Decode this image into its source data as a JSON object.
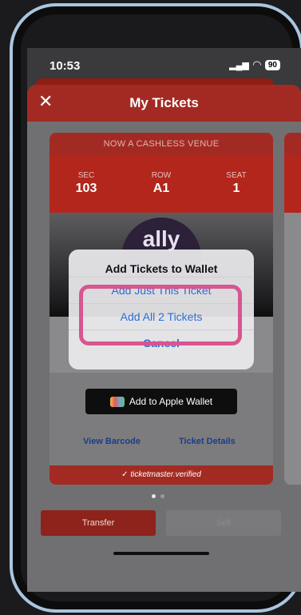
{
  "status_bar": {
    "time": "10:53",
    "battery": "90"
  },
  "header": {
    "title": "My Tickets"
  },
  "ticket": {
    "banner": "NOW A CASHLESS VENUE",
    "sec_label": "SEC",
    "sec_value": "103",
    "row_label": "ROW",
    "row_value": "A1",
    "seat_label": "SEAT",
    "seat_value": "1",
    "logo_text": "ally",
    "wallet_button": "Add to Apple Wallet",
    "view_barcode": "View Barcode",
    "ticket_details": "Ticket Details",
    "verified": "ticketmaster.verified"
  },
  "actions": {
    "transfer": "Transfer",
    "sell": "Sell"
  },
  "dialog": {
    "title": "Add Tickets to Wallet",
    "option1": "Add Just This Ticket",
    "option2": "Add All 2 Tickets",
    "cancel": "Cancel"
  },
  "colors": {
    "brand_red": "#b2261c",
    "link_blue": "#2b6fd6",
    "highlight": "#d8558f"
  }
}
